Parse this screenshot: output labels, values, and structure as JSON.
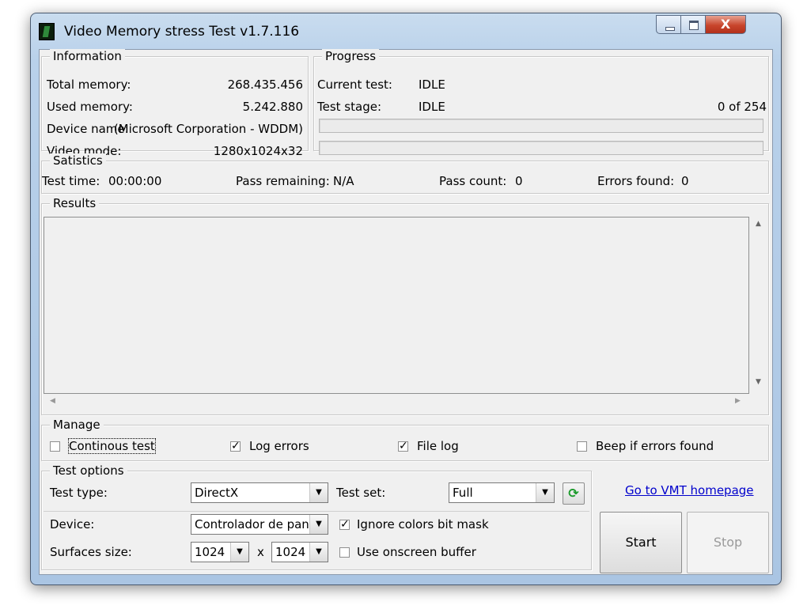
{
  "window": {
    "title": "Video Memory stress Test v1.7.116",
    "close_glyph": "X"
  },
  "information": {
    "legend": "Information",
    "total_memory_label": "Total memory:",
    "total_memory_value": "268.435.456",
    "used_memory_label": "Used memory:",
    "used_memory_value": "5.242.880",
    "device_name_label": "Device name:",
    "device_name_value": "(Microsoft Corporation - WDDM)",
    "video_mode_label": "Video mode:",
    "video_mode_value": "1280x1024x32"
  },
  "progress": {
    "legend": "Progress",
    "current_test_label": "Current test:",
    "current_test_value": "IDLE",
    "test_stage_label": "Test stage:",
    "test_stage_value": "IDLE",
    "stage_counter": "0 of 254",
    "bar1_fraction": 0,
    "bar2_fraction": 0
  },
  "statistics": {
    "legend": "Satistics",
    "test_time_label": "Test time:",
    "test_time_value": "00:00:00",
    "pass_remaining_label": "Pass remaining:",
    "pass_remaining_value": "N/A",
    "pass_count_label": "Pass count:",
    "pass_count_value": "0",
    "errors_found_label": "Errors found:",
    "errors_found_value": "0"
  },
  "results": {
    "legend": "Results"
  },
  "manage": {
    "legend": "Manage",
    "continous_test_label": "Continous test",
    "continous_test_checked": false,
    "log_errors_label": "Log errors",
    "log_errors_checked": true,
    "file_log_label": "File log",
    "file_log_checked": true,
    "beep_label": "Beep if errors found",
    "beep_checked": false,
    "check_glyph": "✓"
  },
  "test_options": {
    "legend": "Test options",
    "test_type_label": "Test type:",
    "test_type_value": "DirectX",
    "test_set_label": "Test set:",
    "test_set_value": "Full",
    "device_label": "Device:",
    "device_value": "Controlador de pant",
    "ignore_colors_label": "Ignore colors bit mask",
    "ignore_colors_checked": true,
    "surfaces_label": "Surfaces size:",
    "surface_width": "1024",
    "surface_x": "x",
    "surface_height": "1024",
    "onscreen_label": "Use onscreen buffer",
    "onscreen_checked": false,
    "dropdown_glyph": "▼"
  },
  "actions": {
    "homepage_link": "Go to VMT homepage",
    "start_label": "Start",
    "stop_label": "Stop"
  },
  "colors": {
    "link": "#0000cc",
    "disabled_text": "#9a9a9a",
    "refresh_icon": "#1a9a2a"
  }
}
